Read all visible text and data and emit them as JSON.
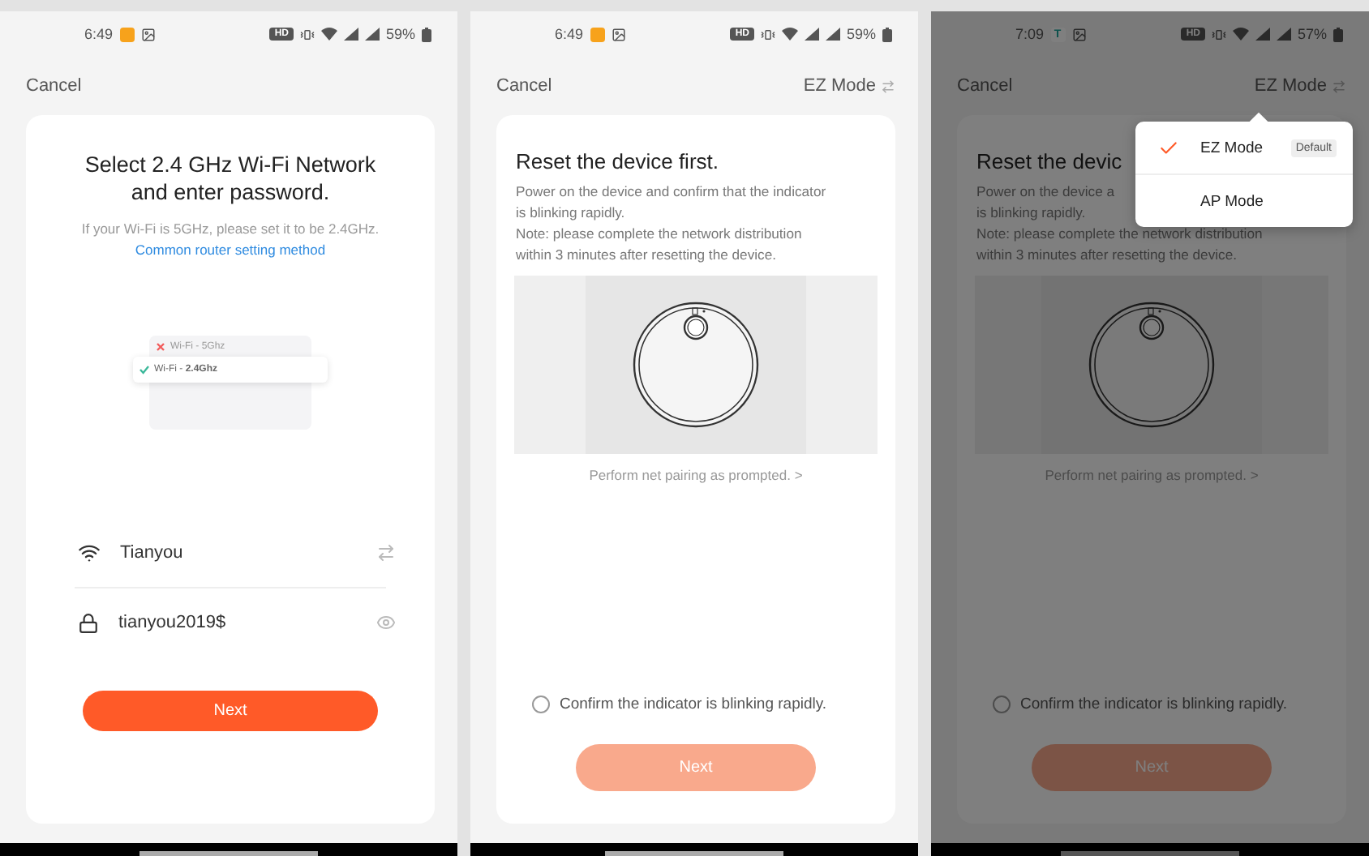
{
  "screens": [
    {
      "kind": "wifi",
      "status_bar": {
        "time": "6:49",
        "network_badge": "HD",
        "battery": "59%"
      },
      "cancel": "Cancel",
      "title": "Select 2.4 GHz Wi-Fi Network and enter password.",
      "hint": "If your Wi-Fi is 5GHz, please set it to be 2.4GHz.",
      "link": "Common router setting method",
      "illustration_rows": [
        {
          "label": "Wi-Fi - 5Ghz",
          "ok": false
        },
        {
          "label": "Wi-Fi - **2.4Ghz**",
          "ok": true
        }
      ],
      "ssid": "Tianyou",
      "password": "tianyou2019$",
      "next": {
        "label": "Next",
        "disabled": false
      }
    },
    {
      "kind": "reset",
      "status_bar": {
        "time": "6:49",
        "network_badge": "HD",
        "battery": "59%"
      },
      "cancel": "Cancel",
      "mode": "EZ Mode",
      "dimmed": false,
      "title": "Reset the device first.",
      "description": [
        "Power on the device and confirm that the indicator",
        "is blinking rapidly."
      ],
      "note": [
        "Note: please complete the network distribution",
        "within 3 minutes after resetting the device."
      ],
      "caption": "Perform net pairing as prompted. >",
      "confirm": {
        "label": "Confirm the indicator is blinking rapidly.",
        "checked": false
      },
      "next": {
        "label": "Next",
        "disabled": true
      }
    },
    {
      "kind": "reset",
      "status_bar": {
        "time": "7:09",
        "app_letter": "T",
        "network_badge": "HD",
        "battery": "57%"
      },
      "cancel": "Cancel",
      "mode": "EZ Mode",
      "dimmed": true,
      "title": "Reset the devic",
      "description": [
        "Power on the device a",
        "is blinking rapidly."
      ],
      "note": [
        "Note: please complete the network distribution",
        "within 3 minutes after resetting the device."
      ],
      "caption": "Perform net pairing as prompted. >",
      "confirm": {
        "label": "Confirm the indicator is blinking rapidly.",
        "checked": false
      },
      "next": {
        "label": "Next",
        "disabled": true
      },
      "menu": {
        "items": [
          {
            "label": "EZ Mode",
            "selected": true,
            "badge": "Default"
          },
          {
            "label": "AP Mode",
            "selected": false
          }
        ]
      }
    }
  ]
}
